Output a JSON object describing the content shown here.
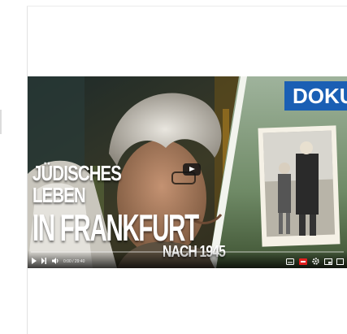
{
  "video": {
    "title_lines": [
      "JÜDISCHES",
      "LEBEN",
      "IN FRANKFURT",
      "NACH 1945"
    ],
    "badge": "DOKU",
    "time": "0:00 / 29:40",
    "progress": 0.0
  },
  "icons": [
    "play-icon",
    "next-icon",
    "volume-icon",
    "subtitles-icon",
    "captions-icon",
    "settings-icon",
    "miniplayer-icon",
    "fullscreen-icon"
  ],
  "colors": {
    "badge": "#1a5fb4",
    "controls_bg": "#000000"
  }
}
